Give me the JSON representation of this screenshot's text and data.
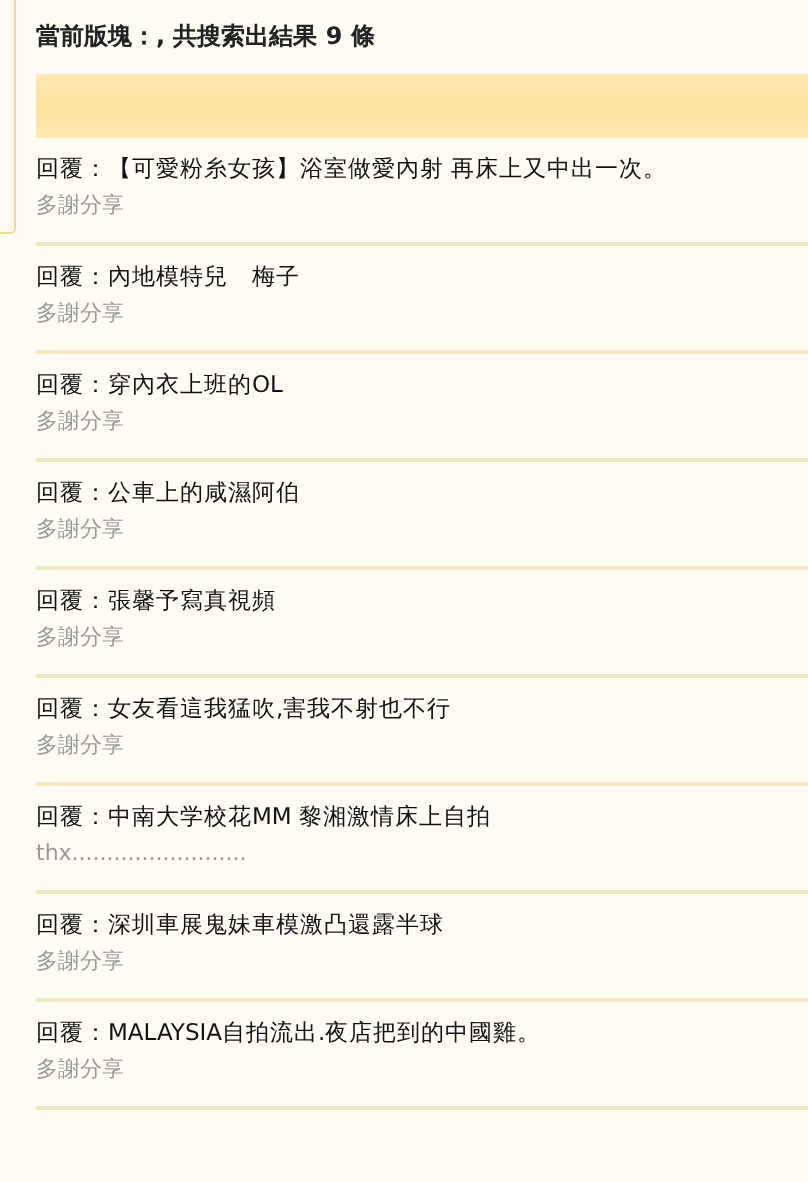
{
  "header": "當前版塊：, 共搜索出結果 9 條",
  "results": [
    {
      "title": "回覆：【可愛粉糸女孩】浴室做愛內射 再床上又中出一次。",
      "reply": "多謝分享"
    },
    {
      "title": "回覆：內地模特兒　梅子",
      "reply": "多謝分享"
    },
    {
      "title": "回覆：穿內衣上班的OL",
      "reply": "多謝分享"
    },
    {
      "title": "回覆：公車上的咸濕阿伯",
      "reply": "多謝分享"
    },
    {
      "title": "回覆：張馨予寫真視頻",
      "reply": "多謝分享"
    },
    {
      "title": "回覆：女友看這我猛吹,害我不射也不行",
      "reply": "多謝分享"
    },
    {
      "title": "回覆：中南大学校花MM 黎湘激情床上自拍",
      "reply": "thx........................."
    },
    {
      "title": "回覆：深圳車展鬼妹車模激凸還露半球",
      "reply": "多謝分享"
    },
    {
      "title": "回覆：MALAYSIA自拍流出.夜店把到的中國雞。",
      "reply": "多謝分享"
    }
  ]
}
